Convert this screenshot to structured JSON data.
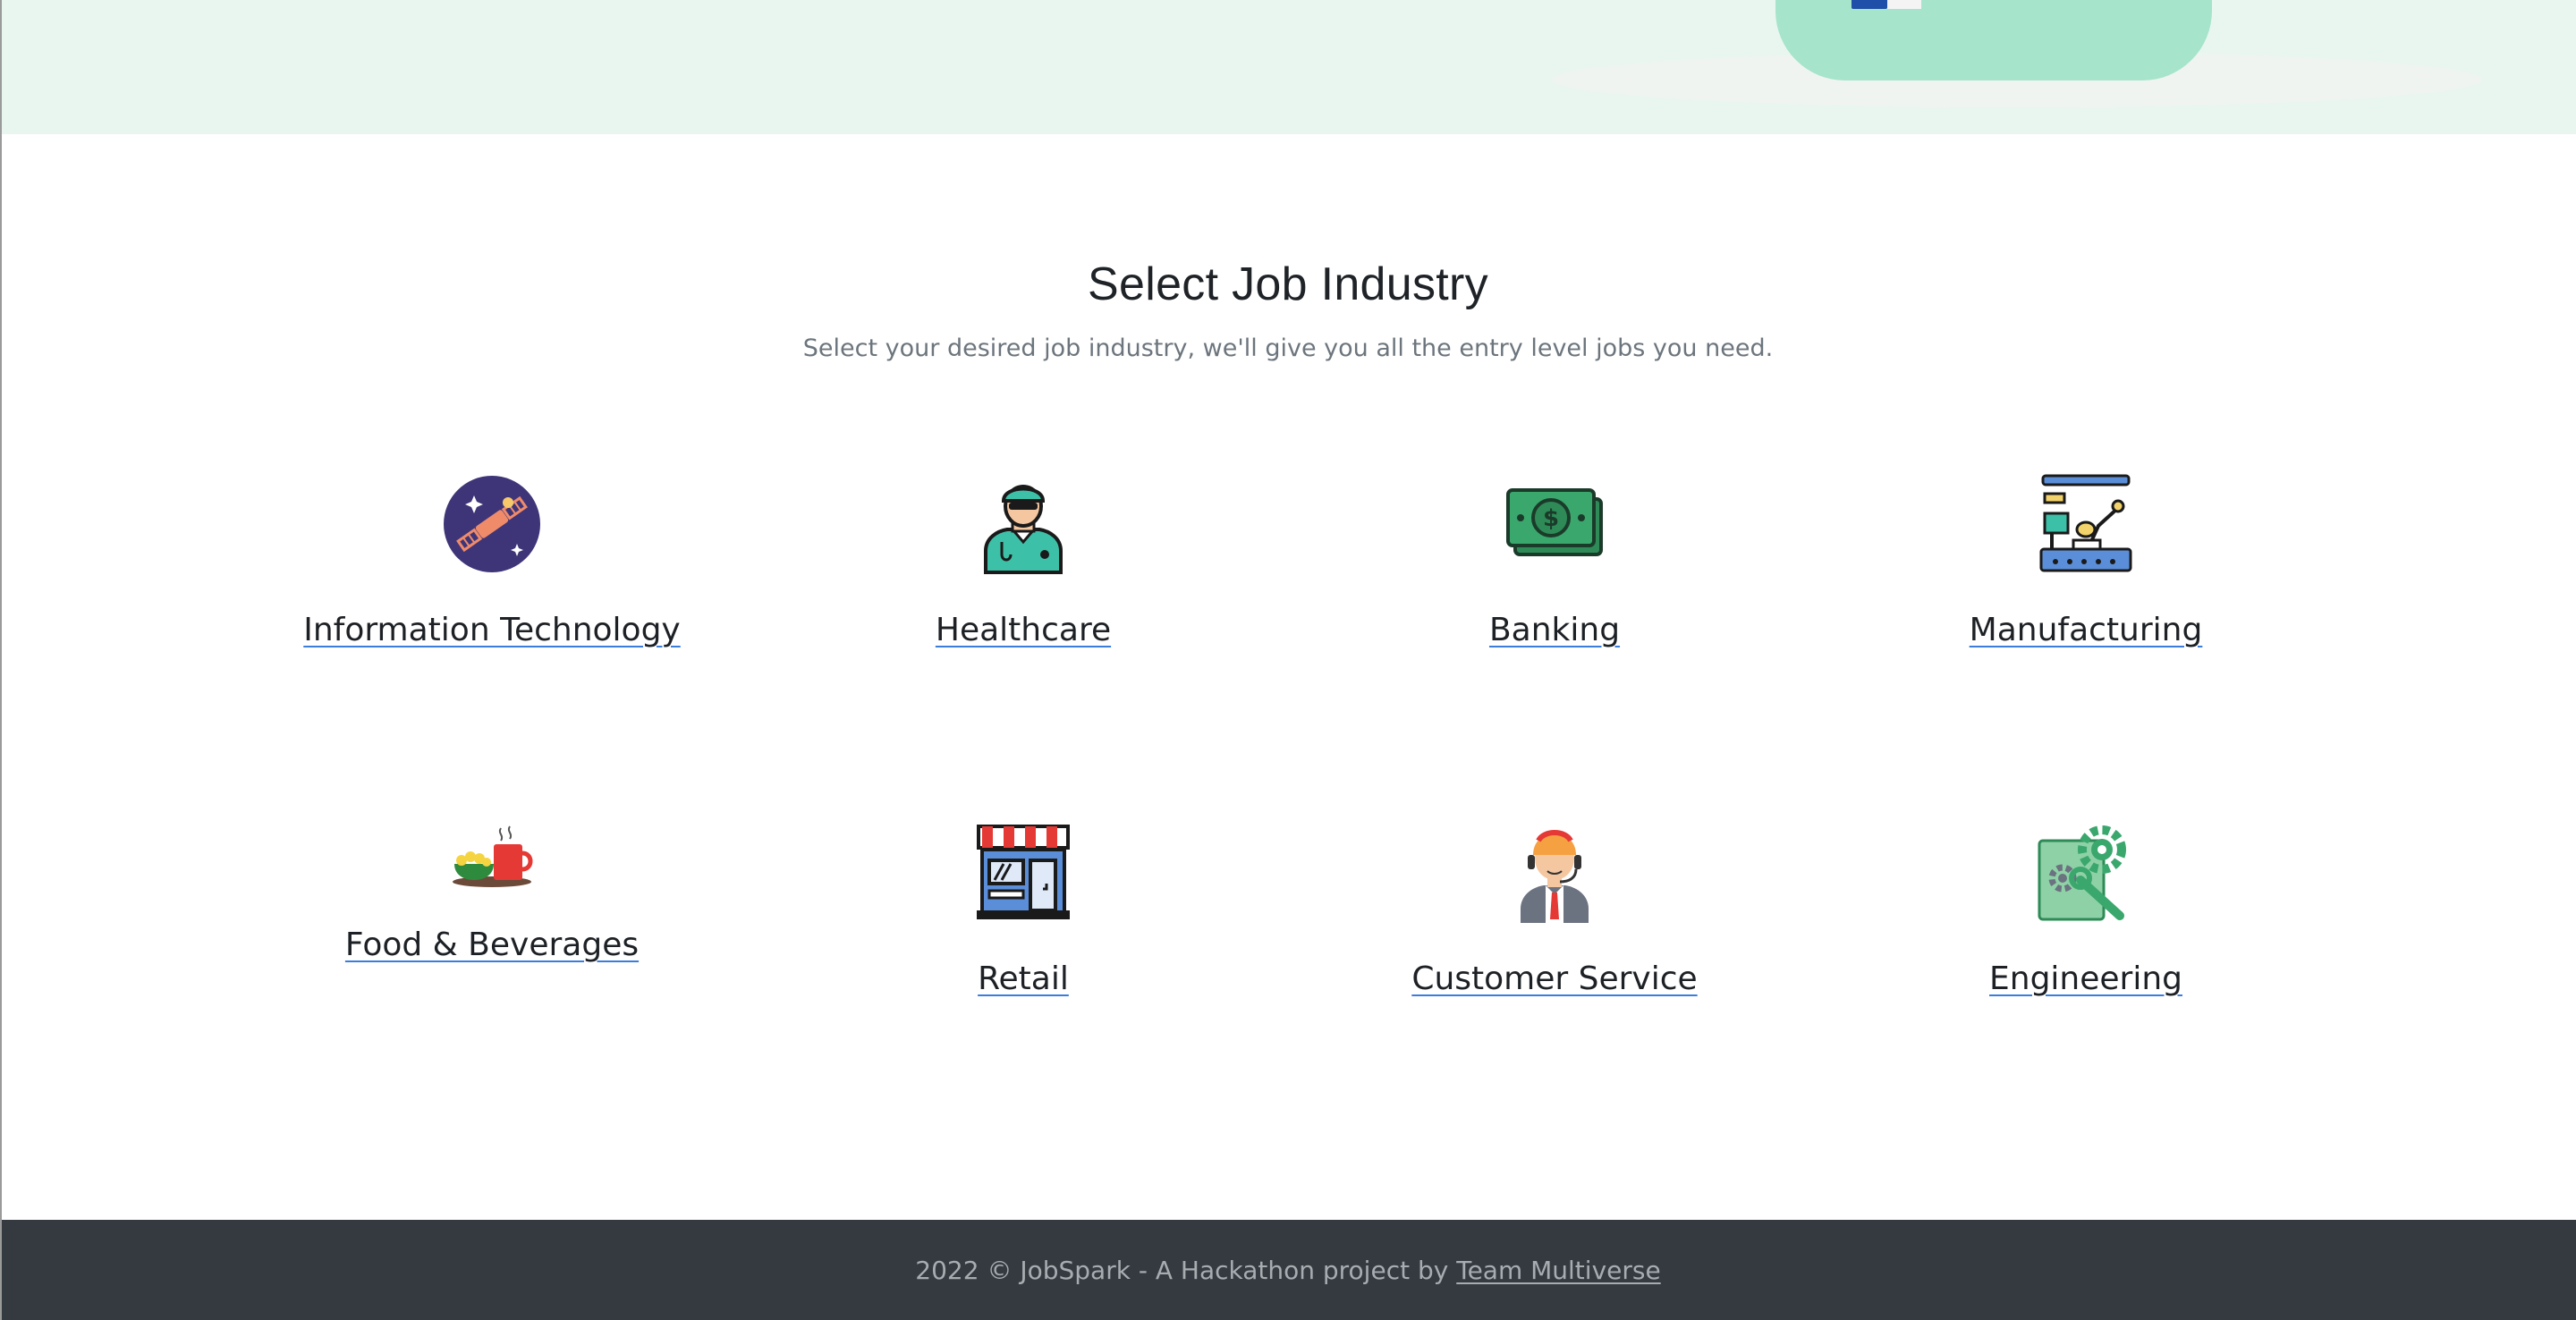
{
  "section": {
    "title": "Select Job Industry",
    "subtitle": "Select your desired job industry, we'll give you all the entry level jobs you need."
  },
  "industries": [
    {
      "label": "Information Technology",
      "icon": "satellite-icon"
    },
    {
      "label": "Healthcare",
      "icon": "doctor-icon"
    },
    {
      "label": "Banking",
      "icon": "money-icon"
    },
    {
      "label": "Manufacturing",
      "icon": "factory-icon"
    },
    {
      "label": "Food & Beverages",
      "icon": "food-icon"
    },
    {
      "label": "Retail",
      "icon": "store-icon"
    },
    {
      "label": "Customer Service",
      "icon": "support-agent-icon"
    },
    {
      "label": "Engineering",
      "icon": "gear-wrench-icon"
    }
  ],
  "footer": {
    "prefix": "2022 © JobSpark - A Hackathon project by",
    "link_text": "Team Multiverse"
  },
  "colors": {
    "hero_bg": "#e9f6ef",
    "hero_blob": "#a6e4cc",
    "footer_bg": "#343a40",
    "link_underline": "#3b7ddd"
  }
}
